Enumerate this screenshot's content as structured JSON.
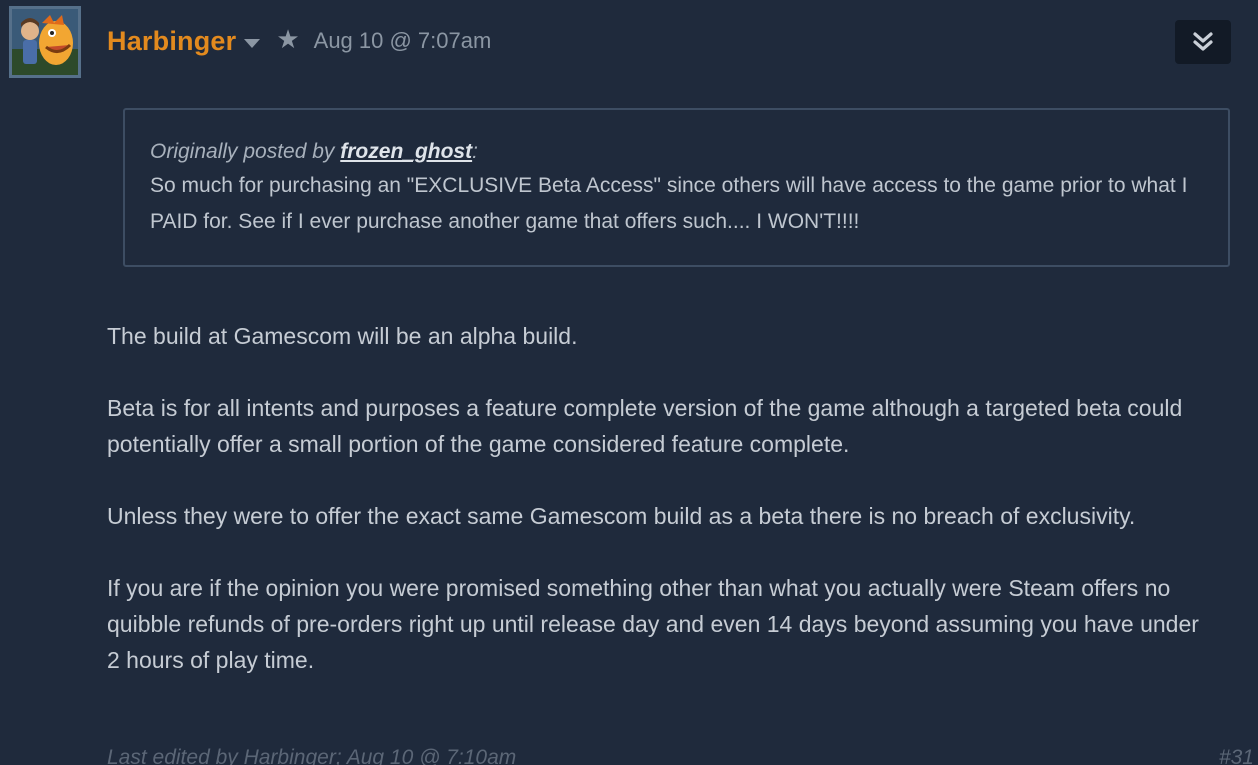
{
  "post": {
    "author": "Harbinger",
    "timestamp": "Aug 10 @ 7:07am",
    "icons": {
      "avatar": "avatar-image",
      "author_menu": "caret-down-icon",
      "badge": "star-icon",
      "expand": "double-chevron-down-icon"
    },
    "quote": {
      "prefix": "Originally posted by ",
      "author": "frozen_ghost",
      "suffix": ":",
      "text": "So much for purchasing an \"EXCLUSIVE Beta Access\" since others will have access to the game prior to what I PAID for. See if I ever purchase another game that offers such.... I WON'T!!!!"
    },
    "paragraphs": [
      "The build at Gamescom will be an alpha build.",
      "Beta is for all intents and purposes a feature complete version of the game although a targeted beta could potentially offer a small portion of the game considered feature complete.",
      "Unless they were to offer the exact same Gamescom build as a beta there is no breach of exclusivity.",
      "If you are if the opinion you were promised something other than what you actually were Steam offers no quibble refunds of pre-orders right up until release day and even 14 days beyond assuming you have under 2 hours of play time."
    ],
    "edited_note": "Last edited by Harbinger; Aug 10 @ 7:10am",
    "post_number": "#31"
  },
  "colors": {
    "background": "#1f2a3c",
    "author": "#e38a1e",
    "text": "#c6ccd4",
    "muted": "#8b96a3",
    "quote_border": "#3d4d63"
  }
}
